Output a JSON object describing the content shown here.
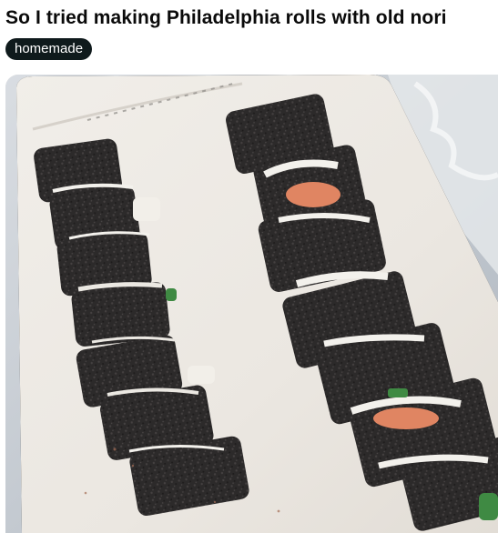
{
  "post": {
    "title": "So I tried making Philadelphia rolls with old nori",
    "flair": "homemade"
  },
  "photo": {
    "subject": "sushi-photo",
    "colors": {
      "tray": "#eeebe6",
      "nori": "#2f2c2c",
      "cream_cheese": "#f3f1ec",
      "salmon": "#e08562",
      "cucumber": "#3f8a43",
      "background": "#c9cfd6"
    }
  }
}
